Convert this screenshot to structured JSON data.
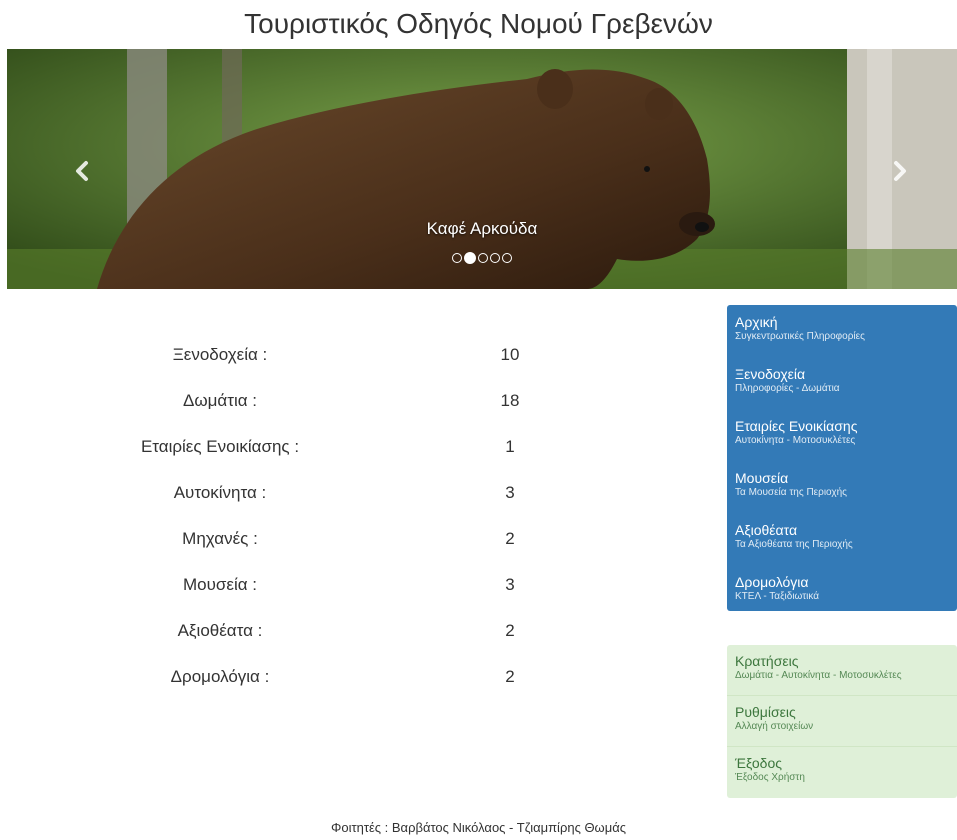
{
  "header": {
    "title": "Τουριστικός Οδηγός Νομού Γρεβενών"
  },
  "carousel": {
    "caption": "Καφέ Αρκούδα",
    "slide_count": 5,
    "active_index": 1,
    "prev_icon": "chevron-left-icon",
    "next_icon": "chevron-right-icon"
  },
  "stats": [
    {
      "label": "Ξενοδοχεία :",
      "value": "10"
    },
    {
      "label": "Δωμάτια :",
      "value": "18"
    },
    {
      "label": "Εταιρίες Ενοικίασης :",
      "value": "1"
    },
    {
      "label": "Αυτοκίνητα :",
      "value": "3"
    },
    {
      "label": "Μηχανές :",
      "value": "2"
    },
    {
      "label": "Μουσεία :",
      "value": "3"
    },
    {
      "label": "Αξιοθέατα :",
      "value": "2"
    },
    {
      "label": "Δρομολόγια :",
      "value": "2"
    }
  ],
  "nav_main": [
    {
      "title": "Αρχική",
      "subtitle": "Συγκεντρωτικές Πληροφορίες"
    },
    {
      "title": "Ξενοδοχεία",
      "subtitle": "Πληροφορίες - Δωμάτια"
    },
    {
      "title": "Εταιρίες Ενοικίασης",
      "subtitle": "Αυτοκίνητα - Μοτοσυκλέτες"
    },
    {
      "title": "Μουσεία",
      "subtitle": "Τα Μουσεία της Περιοχής"
    },
    {
      "title": "Αξιοθέατα",
      "subtitle": "Τα Αξιοθέατα της Περιοχής"
    },
    {
      "title": "Δρομολόγια",
      "subtitle": "ΚΤΕΛ - Ταξιδιωτικά"
    }
  ],
  "nav_user": [
    {
      "title": "Κρατήσεις",
      "subtitle": "Δωμάτια - Αυτοκίνητα - Μοτοσυκλέτες"
    },
    {
      "title": "Ρυθμίσεις",
      "subtitle": "Αλλαγή στοιχείων"
    },
    {
      "title": "Έξοδος",
      "subtitle": "Έξοδος Χρήστη"
    }
  ],
  "footer": {
    "text": "Φοιτητές : Βαρβάτος Νικόλαος - Τζιαμπίρης Θωμάς"
  },
  "colors": {
    "primary": "#337ab7",
    "success_bg": "#dff0d8",
    "success_text": "#3c763d"
  }
}
